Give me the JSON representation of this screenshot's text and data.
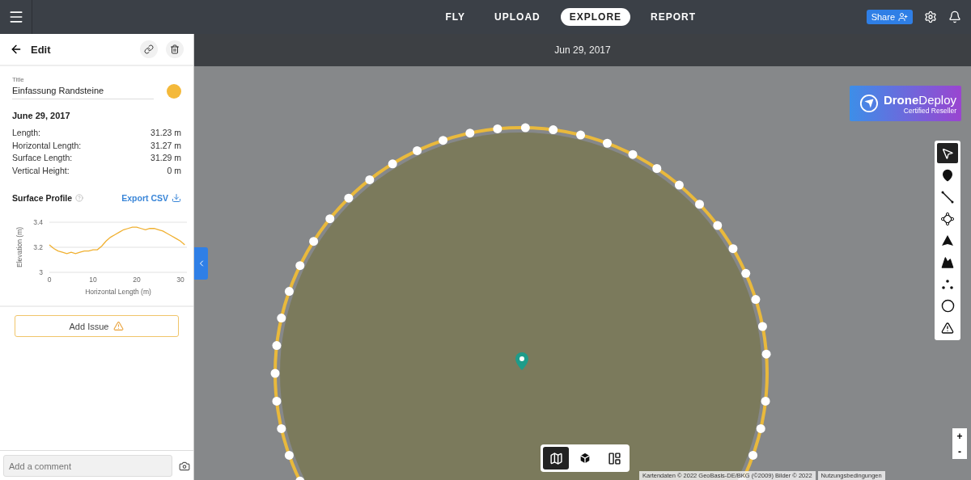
{
  "nav": {
    "tabs": [
      {
        "label": "FLY",
        "selected": false
      },
      {
        "label": "UPLOAD",
        "selected": false
      },
      {
        "label": "EXPLORE",
        "selected": true
      },
      {
        "label": "REPORT",
        "selected": false
      }
    ],
    "share": "Share"
  },
  "panel": {
    "heading": "Edit",
    "title_label": "Title",
    "title_value": "Einfassung Randsteine",
    "color": "#f4b93a",
    "date": "June 29, 2017",
    "stats": [
      {
        "label": "Length:",
        "value": "31.23 m"
      },
      {
        "label": "Horizontal Length:",
        "value": "31.27 m"
      },
      {
        "label": "Surface Length:",
        "value": "31.29 m"
      },
      {
        "label": "Vertical Height:",
        "value": "0 m"
      }
    ],
    "profile_title": "Surface Profile",
    "export": "Export CSV",
    "chart_data": {
      "type": "line",
      "xlabel": "Horizontal Length (m)",
      "ylabel": "Elevation (m)",
      "xlim": [
        0,
        31.5
      ],
      "ylim": [
        3,
        3.4
      ],
      "xticks": [
        0,
        10,
        20,
        30
      ],
      "yticks": [
        3,
        3.2,
        3.4
      ],
      "x": [
        0,
        1,
        2,
        3,
        4,
        5,
        6,
        7,
        8,
        9,
        10,
        11,
        12,
        13,
        14,
        15,
        16,
        17,
        18,
        19,
        20,
        21,
        22,
        23,
        24,
        25,
        26,
        27,
        28,
        29,
        30,
        31
      ],
      "series": [
        {
          "color": "#f0b030",
          "values": [
            3.22,
            3.19,
            3.17,
            3.16,
            3.15,
            3.16,
            3.15,
            3.16,
            3.17,
            3.17,
            3.18,
            3.18,
            3.21,
            3.25,
            3.28,
            3.3,
            3.32,
            3.34,
            3.35,
            3.36,
            3.36,
            3.35,
            3.34,
            3.35,
            3.35,
            3.34,
            3.33,
            3.31,
            3.29,
            3.27,
            3.25,
            3.22
          ]
        }
      ]
    },
    "add_issue": "Add Issue",
    "comment_placeholder": "Add a comment"
  },
  "map": {
    "date": "Jun 29, 2017",
    "logo_name": "**Drone**Deploy",
    "logo_sub": "Certified Reseller",
    "tools": [
      {
        "kind": "select",
        "selected": true
      },
      {
        "kind": "pin",
        "selected": false
      },
      {
        "kind": "line",
        "selected": false
      },
      {
        "kind": "area",
        "selected": false
      },
      {
        "kind": "volume",
        "selected": false
      },
      {
        "kind": "terrain",
        "selected": false
      },
      {
        "kind": "points",
        "selected": false
      },
      {
        "kind": "circle",
        "selected": false
      },
      {
        "kind": "issue",
        "selected": false
      }
    ],
    "zoom_in": "+",
    "zoom_out": "-",
    "views": [
      {
        "kind": "map",
        "selected": true
      },
      {
        "kind": "model",
        "selected": false
      },
      {
        "kind": "layout",
        "selected": false
      }
    ],
    "attribution": "Kartendaten © 2022 GeoBasis-DE/BKG (©2009) Bilder © 2022",
    "terms": "Nutzungsbedingungen"
  }
}
